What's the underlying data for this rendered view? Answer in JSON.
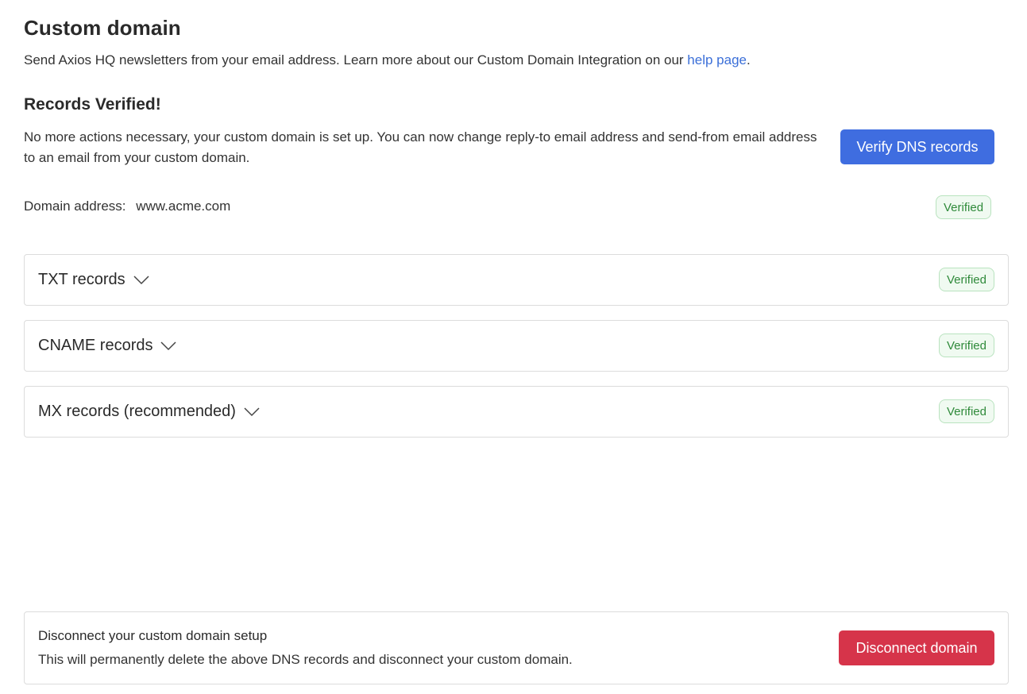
{
  "page": {
    "title": "Custom domain",
    "intro_text": "Send Axios HQ newsletters from your email address. Learn more about our Custom Domain Integration on our ",
    "intro_link": "help page",
    "intro_end": "."
  },
  "status": {
    "heading": "Records Verified!",
    "description": "No more actions necessary, your custom domain is set up. You can now change reply-to email address and send-from email address to an email from your custom domain.",
    "verify_button": "Verify DNS records"
  },
  "domain": {
    "label": "Domain address:",
    "value": "www.acme.com",
    "badge": "Verified"
  },
  "records": [
    {
      "label": "TXT records",
      "badge": "Verified",
      "icon": "chevron-down-icon"
    },
    {
      "label": "CNAME records",
      "badge": "Verified",
      "icon": "chevron-down-icon"
    },
    {
      "label": "MX records (recommended)",
      "badge": "Verified",
      "icon": "chevron-down-icon"
    }
  ],
  "disconnect": {
    "title": "Disconnect your custom domain setup",
    "description": "This will permanently delete the above DNS records and disconnect your custom domain.",
    "button": "Disconnect domain"
  },
  "colors": {
    "primary": "#3f6de0",
    "danger": "#d6344a",
    "link": "#3b6fd8",
    "success_text": "#2f8a3a",
    "success_bg": "#f0faf1",
    "success_border": "#b9e3bf"
  }
}
